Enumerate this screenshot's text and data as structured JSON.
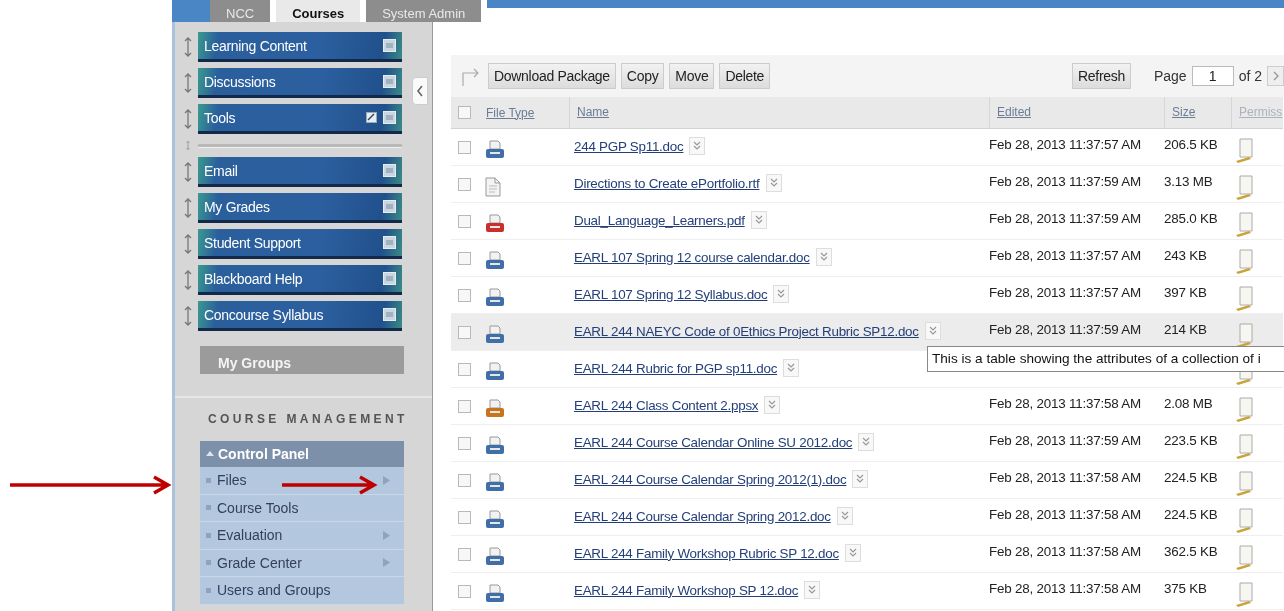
{
  "tabs": [
    {
      "label": "NCC",
      "selected": false
    },
    {
      "label": "Courses",
      "selected": true
    },
    {
      "label": "System Admin",
      "selected": false
    }
  ],
  "sidebar": {
    "modules": [
      {
        "kind": "module",
        "label": "Learning Content",
        "edit_icon": false
      },
      {
        "kind": "module",
        "label": "Discussions",
        "edit_icon": false
      },
      {
        "kind": "module",
        "label": "Tools",
        "edit_icon": true
      },
      {
        "kind": "divider"
      },
      {
        "kind": "module",
        "label": "Email",
        "edit_icon": false
      },
      {
        "kind": "module",
        "label": "My Grades",
        "edit_icon": false
      },
      {
        "kind": "module",
        "label": "Student Support",
        "edit_icon": false
      },
      {
        "kind": "module",
        "label": "Blackboard Help",
        "edit_icon": false
      },
      {
        "kind": "module",
        "label": "Concourse Syllabus",
        "edit_icon": false
      }
    ],
    "my_groups": "My Groups",
    "section_title": "COURSE MANAGEMENT",
    "control_panel": {
      "title": "Control Panel",
      "expanded": true,
      "items": [
        {
          "label": "Files",
          "has_submenu": true
        },
        {
          "label": "Course Tools",
          "has_submenu": false
        },
        {
          "label": "Evaluation",
          "has_submenu": true
        },
        {
          "label": "Grade Center",
          "has_submenu": true
        },
        {
          "label": "Users and Groups",
          "has_submenu": false
        }
      ]
    }
  },
  "toolbar": {
    "buttons": [
      "Download Package",
      "Copy",
      "Move",
      "Delete"
    ],
    "refresh": "Refresh",
    "page_label": "Page",
    "page_value": "1",
    "page_total": "of 2"
  },
  "table": {
    "select_all_checked": false,
    "columns": [
      "File Type",
      "Name",
      "Edited",
      "Size",
      "Permiss"
    ],
    "rows": [
      {
        "checked": false,
        "kind": "doc",
        "name": "244 PGP Sp11.doc",
        "edited": "Feb 28, 2013 11:37:57 AM",
        "size": "206.5 KB",
        "highlighted": false
      },
      {
        "checked": false,
        "kind": "rtf",
        "name": "Directions to Create ePortfolio.rtf",
        "edited": "Feb 28, 2013 11:37:59 AM",
        "size": "3.13 MB",
        "highlighted": false
      },
      {
        "checked": false,
        "kind": "pdf",
        "name": "Dual_Language_Learners.pdf",
        "edited": "Feb 28, 2013 11:37:59 AM",
        "size": "285.0 KB",
        "highlighted": false
      },
      {
        "checked": false,
        "kind": "doc",
        "name": "EARL 107 Spring 12 course calendar.doc",
        "edited": "Feb 28, 2013 11:37:57 AM",
        "size": "243 KB",
        "highlighted": false
      },
      {
        "checked": false,
        "kind": "doc",
        "name": "EARL 107 Spring 12 Syllabus.doc",
        "edited": "Feb 28, 2013 11:37:57 AM",
        "size": "397 KB",
        "highlighted": false
      },
      {
        "checked": false,
        "kind": "doc",
        "name": "EARL 244 NAEYC Code of 0Ethics Project Rubric SP12.doc",
        "edited": "Feb 28, 2013 11:37:59 AM",
        "size": "214 KB",
        "highlighted": true
      },
      {
        "checked": false,
        "kind": "doc",
        "name": "EARL 244 Rubric for PGP sp11.doc",
        "highlighted": false
      },
      {
        "checked": false,
        "kind": "ppsx",
        "name": "EARL 244 Class Content 2.ppsx",
        "edited": "Feb 28, 2013 11:37:58 AM",
        "size": "2.08 MB",
        "highlighted": false
      },
      {
        "checked": false,
        "kind": "doc",
        "name": "EARL 244 Course Calendar Online SU 2012.doc",
        "edited": "Feb 28, 2013 11:37:59 AM",
        "size": "223.5 KB",
        "highlighted": false
      },
      {
        "checked": false,
        "kind": "doc",
        "name": "EARL 244 Course Calendar Spring 2012(1).doc",
        "edited": "Feb 28, 2013 11:37:58 AM",
        "size": "224.5 KB",
        "highlighted": false
      },
      {
        "checked": false,
        "kind": "doc",
        "name": "EARL 244 Course Calendar Spring 2012.doc",
        "edited": "Feb 28, 2013 11:37:58 AM",
        "size": "224.5 KB",
        "highlighted": false
      },
      {
        "checked": false,
        "kind": "doc",
        "name": "EARL 244 Family Workshop Rubric SP 12.doc",
        "edited": "Feb 28, 2013 11:37:58 AM",
        "size": "362.5 KB",
        "highlighted": false
      },
      {
        "checked": false,
        "kind": "doc",
        "name": "EARL 244 Family Workshop SP 12.doc",
        "edited": "Feb 28, 2013 11:37:58 AM",
        "size": "375 KB",
        "highlighted": false
      }
    ]
  },
  "tooltip": "This is a table showing the attributes of a collection of i"
}
